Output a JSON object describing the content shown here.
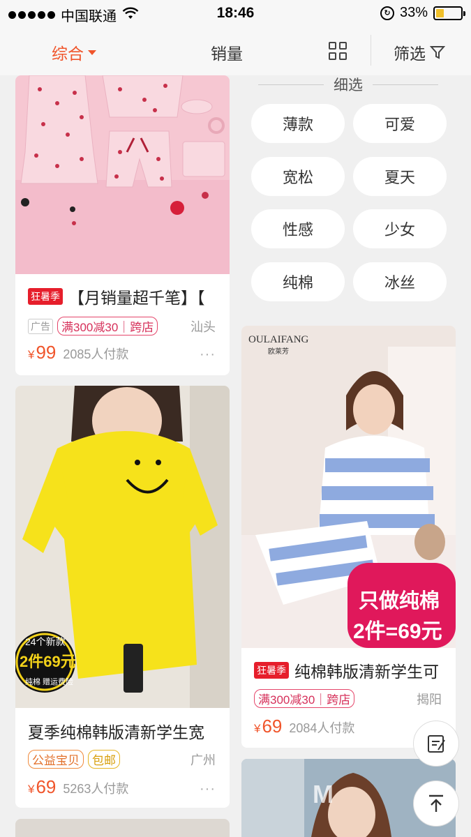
{
  "status_bar": {
    "carrier": "中国联通",
    "time": "18:46",
    "battery_percent": "33%",
    "battery_level": 0.33
  },
  "sort_bar": {
    "comprehensive": "综合",
    "sales": "销量",
    "filter": "筛选"
  },
  "refine": {
    "title": "细选",
    "chips": [
      "薄款",
      "可爱",
      "宽松",
      "夏天",
      "性感",
      "少女",
      "纯棉",
      "冰丝"
    ]
  },
  "products": [
    {
      "badge": "狂暑季",
      "title": "【月销量超千笔】【",
      "ad_label": "广告",
      "promo": "满300减30｜跨店",
      "city": "汕头",
      "currency": "¥",
      "price": "99",
      "paid": "2085人付款",
      "more": "···"
    },
    {
      "badge": "狂暑季",
      "title": "纯棉韩版清新学生可",
      "promo": "满300减30｜跨店",
      "city": "揭阳",
      "currency": "¥",
      "price": "69",
      "paid": "2084人付款",
      "image_brand": "OULAIFANG",
      "image_brand_cn": "欧莱芳",
      "image_banner_1": "只做纯棉",
      "image_banner_2": "2件=69元"
    },
    {
      "title": "夏季纯棉韩版清新学生宽",
      "tag_1": "公益宝贝",
      "tag_2": "包邮",
      "city": "广州",
      "currency": "¥",
      "price": "69",
      "paid": "5263人付款",
      "more": "···",
      "image_badge_1": "24个新款",
      "image_badge_2": "2件69元",
      "image_badge_3": "纯棉 赠运费险"
    }
  ],
  "icons": {
    "edit": "edit-icon",
    "top": "back-to-top-icon",
    "grid": "grid-view-icon",
    "filter": "funnel-icon"
  },
  "colors": {
    "accent": "#f0552b",
    "promo": "#d6305a",
    "badge": "#e61e2b"
  }
}
